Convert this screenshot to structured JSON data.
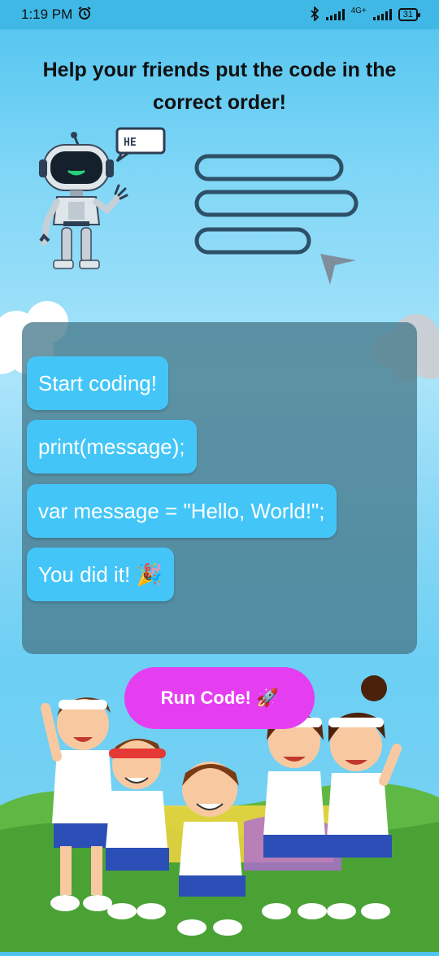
{
  "status_bar": {
    "time": "1:19 PM",
    "network": "4G+",
    "battery": "31"
  },
  "title": "Help your friends put the code in the correct order!",
  "speech_text": "HE",
  "code_blocks": [
    {
      "label": "Start coding!"
    },
    {
      "label": "print(message);"
    },
    {
      "label": "var message = \"Hello, World!\";"
    },
    {
      "label": "You did it! 🎉"
    }
  ],
  "run_button": {
    "label": "Run Code! 🚀"
  },
  "icons": [
    "alarm-icon",
    "bluetooth-icon",
    "signal-icon",
    "battery-icon",
    "robot-icon",
    "code-lines-icon",
    "cursor-icon",
    "cloud-icon",
    "kids-illustration"
  ],
  "colors": {
    "chip": "#43c6f7",
    "button": "#e53ef0",
    "panel": "#487a8c"
  }
}
